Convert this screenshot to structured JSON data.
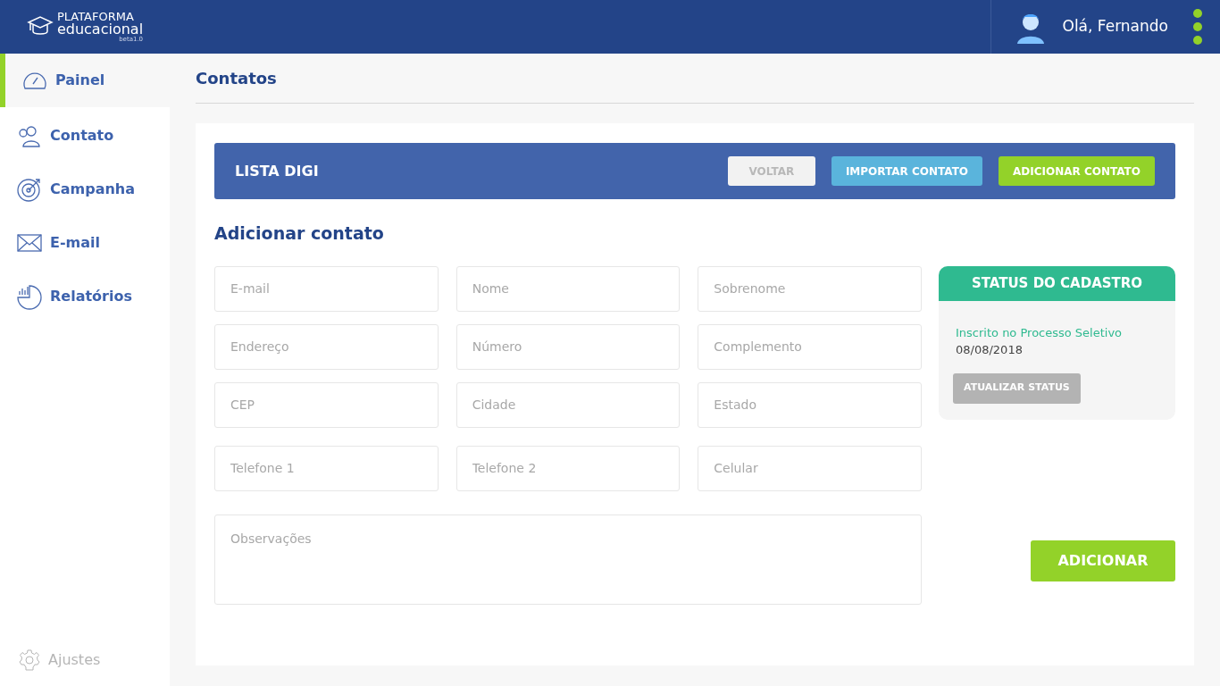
{
  "header": {
    "logo_top": "PLATAFORMA",
    "logo_main": "educacional",
    "logo_version": "beta1.0",
    "greeting": "Olá, Fernando"
  },
  "sidebar": {
    "items": [
      {
        "label": "Painel",
        "kind": "gauge",
        "selected": true
      },
      {
        "label": "Contato",
        "kind": "people",
        "selected": false
      },
      {
        "label": "Campanha",
        "kind": "target",
        "selected": false
      },
      {
        "label": "E-mail",
        "kind": "mail",
        "selected": false
      },
      {
        "label": "Relatórios",
        "kind": "report",
        "selected": false
      }
    ],
    "footer": {
      "label": "Ajustes",
      "disabled": true
    }
  },
  "page_title": "Contatos",
  "list_bar": {
    "title": "LISTA DIGI",
    "buttons": [
      {
        "label": "VOLTAR",
        "kind": "neutral"
      },
      {
        "label": "IMPORTAR CONTATO",
        "kind": "info"
      },
      {
        "label": "ADICIONAR CONTATO",
        "kind": "primary"
      }
    ]
  },
  "form": {
    "title": "Adicionar contato",
    "fields": [
      {
        "placeholder": "E-mail"
      },
      {
        "placeholder": "Nome"
      },
      {
        "placeholder": "Sobrenome"
      },
      {
        "placeholder": "Endereço"
      },
      {
        "placeholder": "Número"
      },
      {
        "placeholder": "Complemento"
      },
      {
        "placeholder": "CEP"
      },
      {
        "placeholder": "Cidade"
      },
      {
        "placeholder": "Estado"
      },
      {
        "placeholder": "Telefone 1"
      },
      {
        "placeholder": "Telefone 2"
      },
      {
        "placeholder": "Celular"
      }
    ],
    "notes": {
      "placeholder": "Observações"
    },
    "submit": "ADICIONAR"
  },
  "status_card": {
    "title": "STATUS DO CADASTRO",
    "status": "Inscrito no Processo Seletivo",
    "date": "08/08/2018",
    "button": {
      "label": "ATUALIZAR STATUS",
      "disabled": true
    }
  }
}
